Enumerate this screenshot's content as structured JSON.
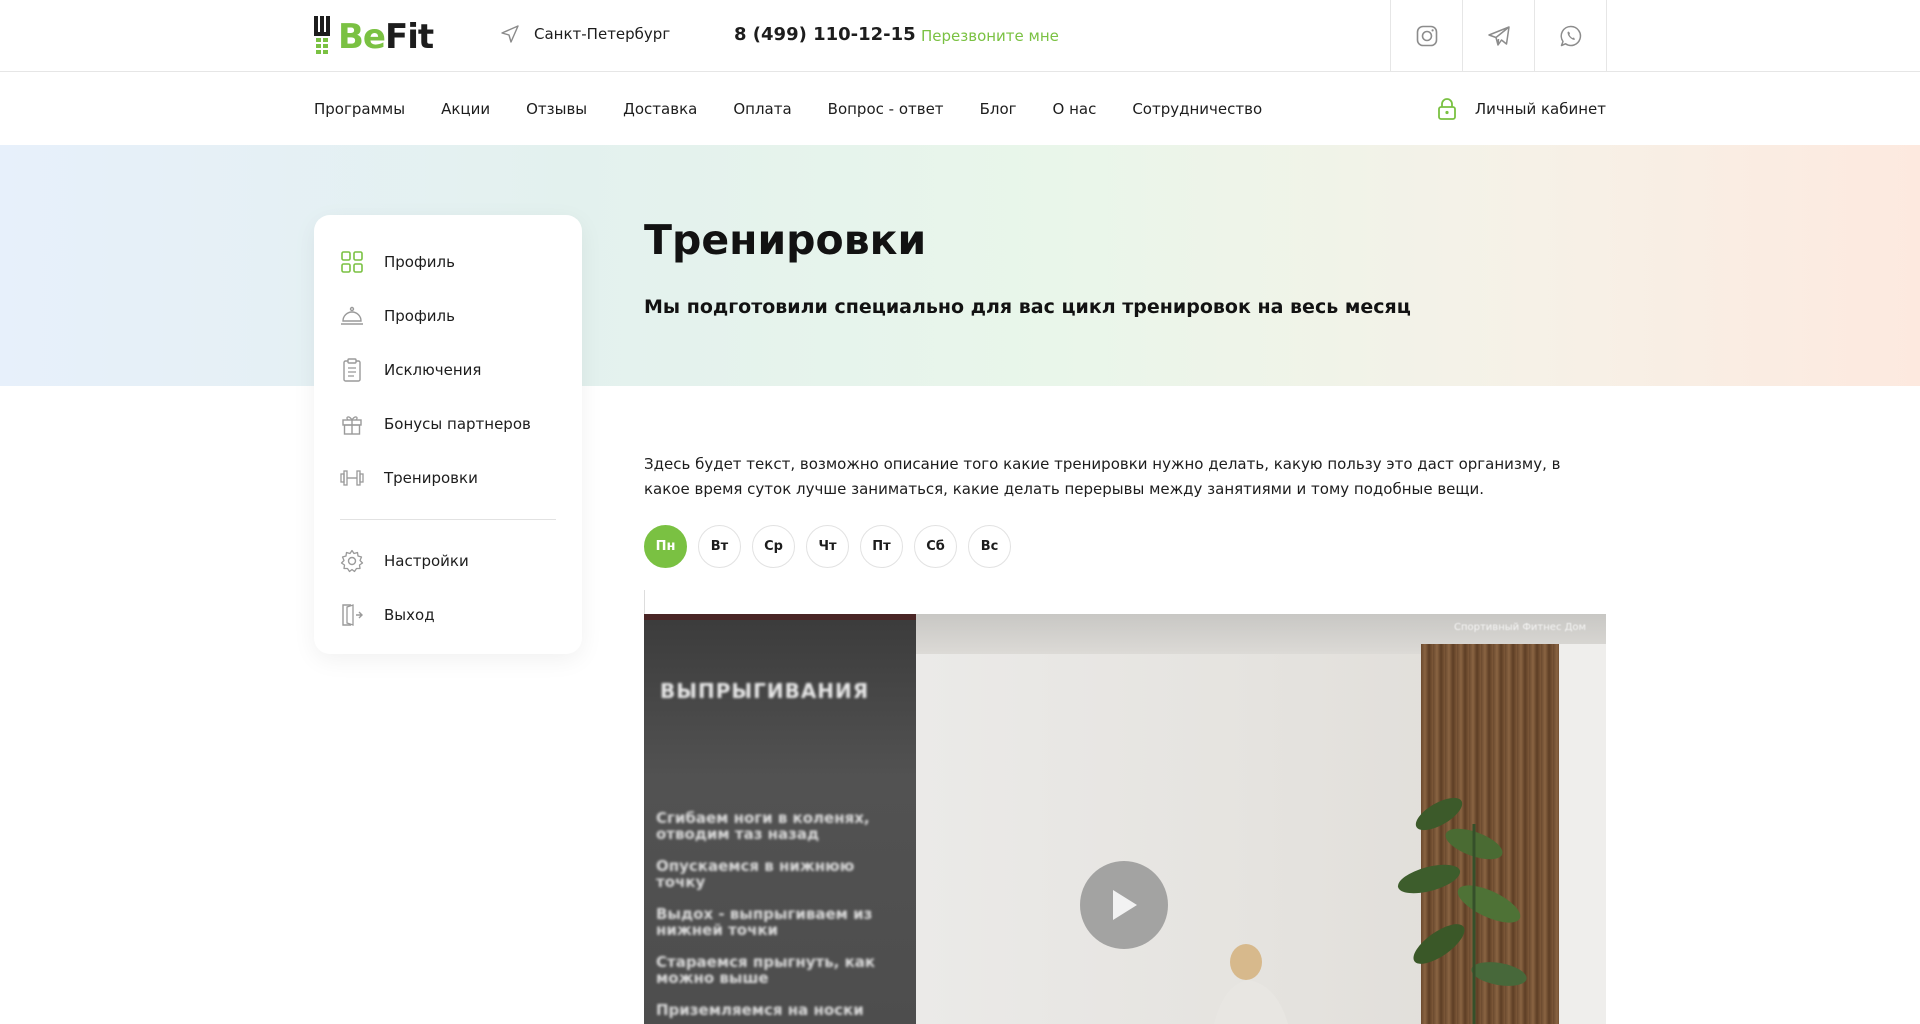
{
  "header": {
    "logo": {
      "part1": "Be",
      "part2": "Fit"
    },
    "city": "Санкт-Петербург",
    "phone": "8 (499) 110-12-15",
    "callback": "Перезвоните мне",
    "socials": [
      "instagram-icon",
      "telegram-icon",
      "whatsapp-icon"
    ]
  },
  "nav": {
    "items": [
      "Программы",
      "Акции",
      "Отзывы",
      "Доставка",
      "Оплата",
      "Вопрос - ответ",
      "Блог",
      "О нас",
      "Сотрудничество"
    ],
    "account": "Личный кабинет"
  },
  "page": {
    "title": "Тренировки",
    "subtitle": "Мы подготовили специально для вас цикл тренировок на весь месяц",
    "description": "Здесь будет текст, возможно описание того какие тренировки нужно делать, какую пользу это даст организму, в какое время суток лучше заниматься, какие делать перерывы между занятиями и тому подобные вещи."
  },
  "sidebar": {
    "items": [
      "Профиль",
      "Профиль",
      "Исключения",
      "Бонусы партнеров",
      "Тренировки"
    ],
    "bottom_items": [
      "Настройки",
      "Выход"
    ]
  },
  "days": {
    "items": [
      "Пн",
      "Вт",
      "Ср",
      "Чт",
      "Пт",
      "Сб",
      "Вс"
    ],
    "active": "Пн"
  },
  "video": {
    "title": "ВЫПРЫГИВАНИЯ",
    "steps": [
      "Сгибаем ноги в коленях, отводим таз назад",
      "Опускаемся в нижнюю точку",
      "Выдох - выпрыгиваем из нижней точки",
      "Стараемся прыгнуть, как можно выше",
      "Приземляемся на носки"
    ],
    "watermark": "Спортивный Фитнес Дом"
  },
  "colors": {
    "accent": "#7ac142",
    "text": "#1d1d1d"
  }
}
